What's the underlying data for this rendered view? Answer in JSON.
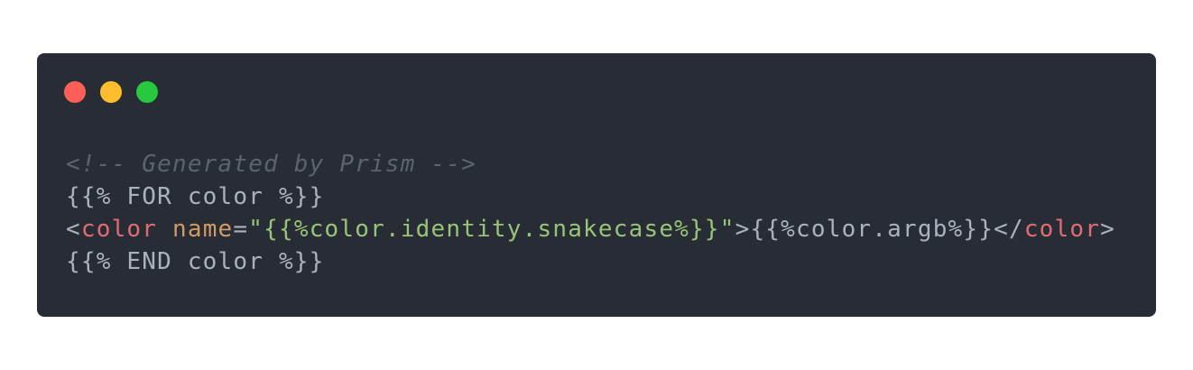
{
  "window": {
    "controls": [
      {
        "name": "close",
        "color": "#ff5f56"
      },
      {
        "name": "minimize",
        "color": "#ffbd2e"
      },
      {
        "name": "maximize",
        "color": "#27c93f"
      }
    ]
  },
  "code": {
    "line1": "<!-- Generated by Prism -->",
    "line2": "{{% FOR color %}}",
    "line3": {
      "open_bracket": "<",
      "tag": "color",
      "space": " ",
      "attr": "name",
      "equals": "=",
      "value": "\"{{%color.identity.snakecase%}}\"",
      "close_bracket": ">",
      "content": "{{%color.argb%}}",
      "end_open": "</",
      "end_tag": "color",
      "end_close": ">"
    },
    "line4": "{{% END color %}}"
  },
  "colors": {
    "background": "#282c34",
    "text": "#abb2bf",
    "comment": "#5c6370",
    "tag": "#e06c75",
    "attribute": "#d19a66",
    "string": "#98c379"
  }
}
